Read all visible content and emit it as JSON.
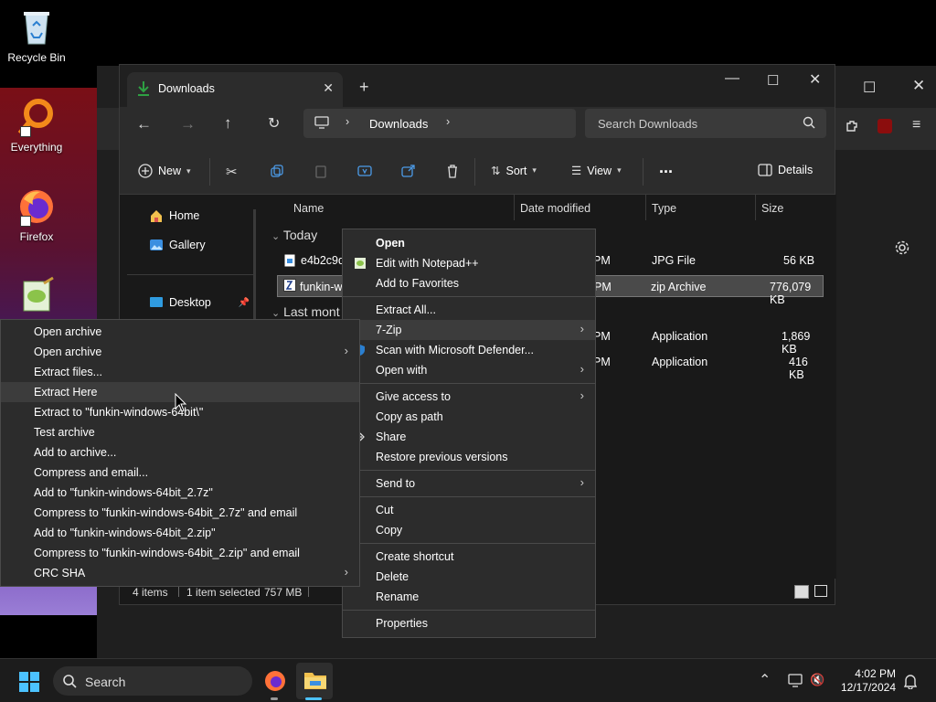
{
  "desktop": {
    "icons": [
      {
        "label": "Recycle Bin"
      },
      {
        "label": "Everything"
      },
      {
        "label": "Firefox"
      }
    ]
  },
  "explorer": {
    "tab_title": "Downloads",
    "breadcrumb": "Downloads",
    "search_placeholder": "Search Downloads",
    "toolbar": {
      "new_label": "New",
      "sort_label": "Sort",
      "view_label": "View",
      "more_label": "...",
      "details_label": "Details"
    },
    "sidebar": {
      "home": "Home",
      "gallery": "Gallery",
      "desktop": "Desktop"
    },
    "columns": {
      "name": "Name",
      "date": "Date modified",
      "type": "Type",
      "size": "Size"
    },
    "groups": {
      "today": "Today",
      "last_month": "Last mont"
    },
    "rows": [
      {
        "name": "e4b2c9d",
        "date": "PM",
        "type": "JPG File",
        "size": "56 KB"
      },
      {
        "name": "funkin-w",
        "date": "PM",
        "type": "zip Archive",
        "size": "776,079 KB"
      },
      {
        "date": "PM",
        "type": "Application",
        "size": "1,869 KB"
      },
      {
        "date": "PM",
        "type": "Application",
        "size": "416 KB"
      }
    ],
    "status": {
      "items": "4 items",
      "selected": "1 item selected",
      "size": "757 MB"
    }
  },
  "context_menu": {
    "items": [
      "Open",
      "Edit with Notepad++",
      "Add to Favorites",
      "Extract All...",
      "7-Zip",
      "Scan with Microsoft Defender...",
      "Open with",
      "Give access to",
      "Copy as path",
      "Share",
      "Restore previous versions",
      "Send to",
      "Cut",
      "Copy",
      "Create shortcut",
      "Delete",
      "Rename",
      "Properties"
    ]
  },
  "zip_menu": {
    "items": [
      "Open archive",
      "Open archive",
      "Extract files...",
      "Extract Here",
      "Extract to \"funkin-windows-64bit\\\"",
      "Test archive",
      "Add to archive...",
      "Compress and email...",
      "Add to \"funkin-windows-64bit_2.7z\"",
      "Compress to \"funkin-windows-64bit_2.7z\" and email",
      "Add to \"funkin-windows-64bit_2.zip\"",
      "Compress to \"funkin-windows-64bit_2.zip\" and email",
      "CRC SHA"
    ]
  },
  "taskbar": {
    "search_label": "Search",
    "time": "4:02 PM",
    "date": "12/17/2024"
  },
  "colors": {
    "accent_green": "#2ea043",
    "folder_yellow": "#f2c14e",
    "menu_bg": "#2c2c2c"
  }
}
